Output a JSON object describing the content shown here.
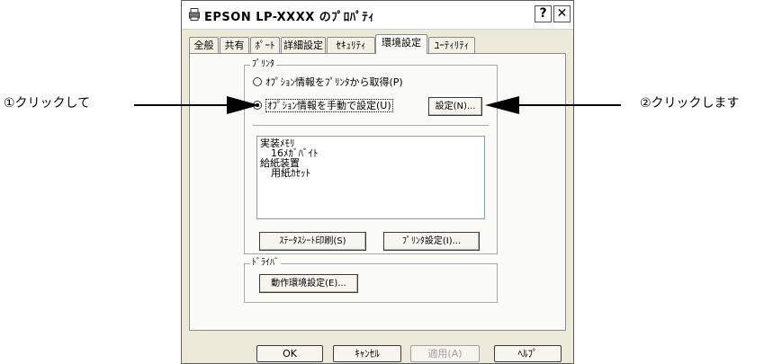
{
  "callouts": {
    "left": "①クリックして",
    "right": "②クリックします"
  },
  "window": {
    "title": "EPSON LP-XXXX のﾌﾟﾛﾊﾟﾃｨ",
    "help_label": "?",
    "close_label": "✕",
    "title_icon": "printer-icon"
  },
  "tabs": [
    {
      "label": "全般"
    },
    {
      "label": "共有"
    },
    {
      "label": "ﾎﾟｰﾄ"
    },
    {
      "label": "詳細設定"
    },
    {
      "label": "ｾｷｭﾘﾃｨ"
    },
    {
      "label": "環境設定",
      "active": true
    },
    {
      "label": "ﾕｰﾃｨﾘﾃｨ"
    }
  ],
  "printer_group": {
    "label": "ﾌﾟﾘﾝﾀ",
    "radio_auto": "ｵﾌﾟｼｮﾝ情報をﾌﾟﾘﾝﾀから取得(P)",
    "radio_manual": "ｵﾌﾟｼｮﾝ情報を手動で設定(U)",
    "settings_button": "設定(N)...",
    "list_items": [
      {
        "text": "実装ﾒﾓﾘ",
        "indent": false
      },
      {
        "text": "16ﾒｶﾞﾊﾞｲﾄ",
        "indent": true
      },
      {
        "text": "給紙装置",
        "indent": false
      },
      {
        "text": "用紙ｶｾｯﾄ",
        "indent": true
      }
    ],
    "status_sheet_button": "ｽﾃｰﾀｽｼｰﾄ印刷(S)",
    "printer_settings_button": "ﾌﾟﾘﾝﾀ設定(I)..."
  },
  "driver_group": {
    "label": "ﾄﾞﾗｲﾊﾞ",
    "env_button": "動作環境設定(E)..."
  },
  "footer": {
    "ok": "OK",
    "cancel": "ｷｬﾝｾﾙ",
    "apply": "適用(A)",
    "help": "ﾍﾙﾌﾟ"
  },
  "colors": {
    "dialog_bg": "#ece9d8",
    "panel_bg": "#fbfbf8",
    "listbox_border": "#7f9db9"
  }
}
